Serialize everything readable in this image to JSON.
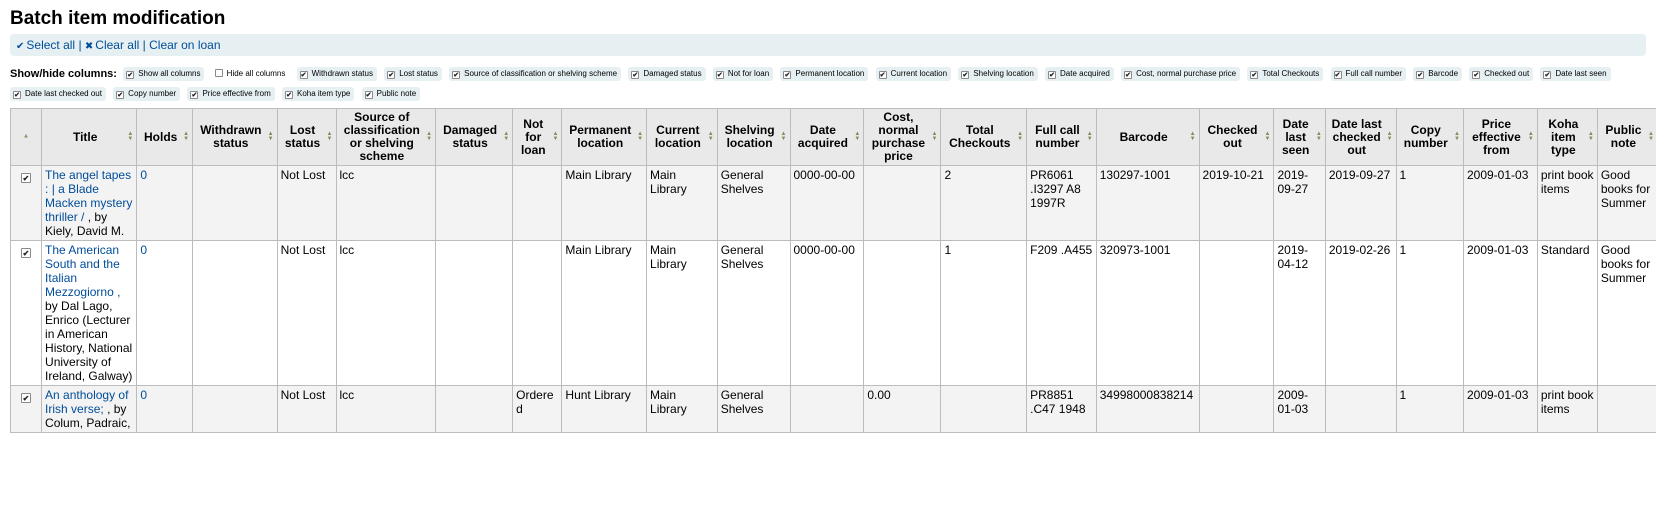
{
  "page_title": "Batch item modification",
  "toolbar": {
    "select_all": "Select all",
    "clear_all": "Clear all",
    "clear_on_loan": "Clear on loan",
    "separator": "|"
  },
  "show_hide": {
    "label": "Show/hide columns:",
    "options": [
      {
        "label": "Show all columns",
        "checked": true
      },
      {
        "label": "Hide all columns",
        "checked": false
      },
      {
        "label": "Withdrawn status",
        "checked": true
      },
      {
        "label": "Lost status",
        "checked": true
      },
      {
        "label": "Source of classification or shelving scheme",
        "checked": true
      },
      {
        "label": "Damaged status",
        "checked": true
      },
      {
        "label": "Not for loan",
        "checked": true
      },
      {
        "label": "Permanent location",
        "checked": true
      },
      {
        "label": "Current location",
        "checked": true
      },
      {
        "label": "Shelving location",
        "checked": true
      },
      {
        "label": "Date acquired",
        "checked": true
      },
      {
        "label": "Cost, normal purchase price",
        "checked": true
      },
      {
        "label": "Total Checkouts",
        "checked": true
      },
      {
        "label": "Full call number",
        "checked": true
      },
      {
        "label": "Barcode",
        "checked": true
      },
      {
        "label": "Checked out",
        "checked": true
      },
      {
        "label": "Date last seen",
        "checked": true
      },
      {
        "label": "Date last checked out",
        "checked": true
      },
      {
        "label": "Copy number",
        "checked": true
      },
      {
        "label": "Price effective from",
        "checked": true
      },
      {
        "label": "Koha item type",
        "checked": true
      },
      {
        "label": "Public note",
        "checked": true
      }
    ]
  },
  "table": {
    "headers": [
      "",
      "Title",
      "Holds",
      "Withdrawn status",
      "Lost status",
      "Source of classification or shelving scheme",
      "Damaged status",
      "Not for loan",
      "Permanent location",
      "Current location",
      "Shelving location",
      "Date acquired",
      "Cost, normal purchase price",
      "Total Checkouts",
      "Full call number",
      "Barcode",
      "Checked out",
      "Date last seen",
      "Date last checked out",
      "Copy number",
      "Price effective from",
      "Koha item type",
      "Public note"
    ],
    "rows": [
      {
        "checked": true,
        "title_link": "The angel tapes : | a Blade Macken mystery thriller /",
        "title_rest": ", by Kiely, David M.",
        "cells": [
          "0",
          "",
          "Not Lost",
          "lcc",
          "",
          "",
          "Main Library",
          "Main Library",
          "General Shelves",
          "0000-00-00",
          "",
          "2",
          "PR6061 .I3297 A8 1997R",
          "130297-1001",
          "2019-10-21",
          "2019-09-27",
          "2019-09-27",
          "1",
          "2009-01-03",
          "print book items",
          "Good books for Summer"
        ]
      },
      {
        "checked": true,
        "title_link": "The American South and the Italian Mezzogiorno ,",
        "title_rest": "by Dal Lago, Enrico (Lecturer in American History, National University of Ireland, Galway)",
        "cells": [
          "0",
          "",
          "Not Lost",
          "lcc",
          "",
          "",
          "Main Library",
          "Main Library",
          "General Shelves",
          "0000-00-00",
          "",
          "1",
          "F209 .A455",
          "320973-1001",
          "",
          "2019-04-12",
          "2019-02-26",
          "1",
          "2009-01-03",
          "Standard",
          "Good books for Summer"
        ]
      },
      {
        "checked": true,
        "title_link": "An anthology of Irish verse;",
        "title_rest": ", by Colum, Padraic,",
        "cells": [
          "0",
          "",
          "Not Lost",
          "lcc",
          "",
          "Ordered",
          "Hunt Library",
          "Main Library",
          "General Shelves",
          "",
          "0.00",
          "",
          "PR8851 .C47 1948",
          "34998000838214",
          "",
          "2009-01-03",
          "",
          "1",
          "2009-01-03",
          "print book items",
          ""
        ]
      }
    ]
  }
}
